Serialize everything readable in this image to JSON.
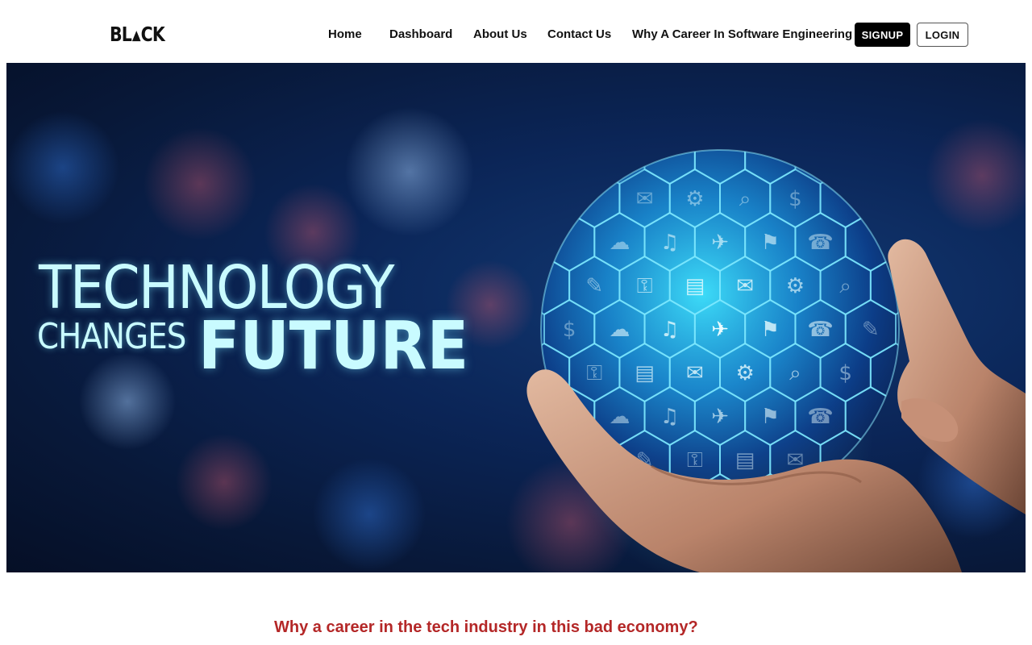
{
  "brand": {
    "logo_left": "BL",
    "logo_mark": "▲",
    "logo_right": "CK"
  },
  "nav": {
    "items": [
      {
        "label": "Home"
      },
      {
        "label": "Dashboard"
      },
      {
        "label": "About Us"
      },
      {
        "label": "Contact Us"
      },
      {
        "label": "Why A Career In Software Engineering"
      }
    ],
    "signup_label": "SIGNUP",
    "login_label": "LOGIN"
  },
  "hero": {
    "line1": "TECHNOLOGY",
    "line2": "CHANGES",
    "line3": "FUTURE"
  },
  "section": {
    "heading": "Why a career in the tech industry in this bad economy?"
  },
  "colors": {
    "heading_red": "#b42727",
    "hero_bg": "#0b2557",
    "hero_text": "#c9fbff",
    "globe_cyan": "#2ad4ff"
  }
}
